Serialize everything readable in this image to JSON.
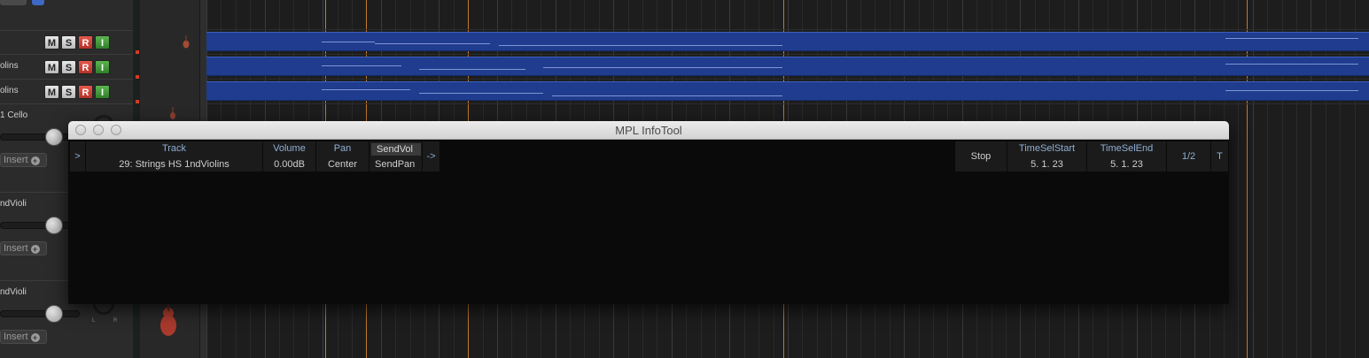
{
  "tracks": [
    {
      "name": "",
      "buttons": [
        "M",
        "S",
        "R",
        "I"
      ]
    },
    {
      "name": "olins",
      "buttons": [
        "M",
        "S",
        "R",
        "I"
      ]
    },
    {
      "name": "olins",
      "buttons": [
        "M",
        "S",
        "R",
        "I"
      ]
    },
    {
      "name": "1 Cello"
    },
    {
      "name": "ndVioli"
    },
    {
      "name": "ndVioli"
    }
  ],
  "insert_label": "Insert",
  "insert_plus": "+",
  "pan_letters": {
    "left": "L",
    "right": "R"
  },
  "infotool": {
    "title": "MPL InfoTool",
    "expand_left": ">",
    "track_label": "Track",
    "track_value": "29: Strings HS 1ndViolins",
    "volume_label": "Volume",
    "volume_value": "0.00dB",
    "pan_label": "Pan",
    "pan_value": "Center",
    "sendvol_label": "SendVol",
    "sendpan_label": "SendPan",
    "next_arrow": "->",
    "transport_state": "Stop",
    "timesel_start_label": "TimeSelStart",
    "timesel_start_value": "5. 1. 23",
    "timesel_end_label": "TimeSelEnd",
    "timesel_end_value": "5. 1. 23",
    "page_indicator": "1/2",
    "t_button": "T"
  },
  "colors": {
    "record": "#c8402f",
    "input": "#3e9a36",
    "midi_item": "#1f3c8e",
    "marker": "#c37a2a",
    "label_blue": "#8faed4"
  }
}
